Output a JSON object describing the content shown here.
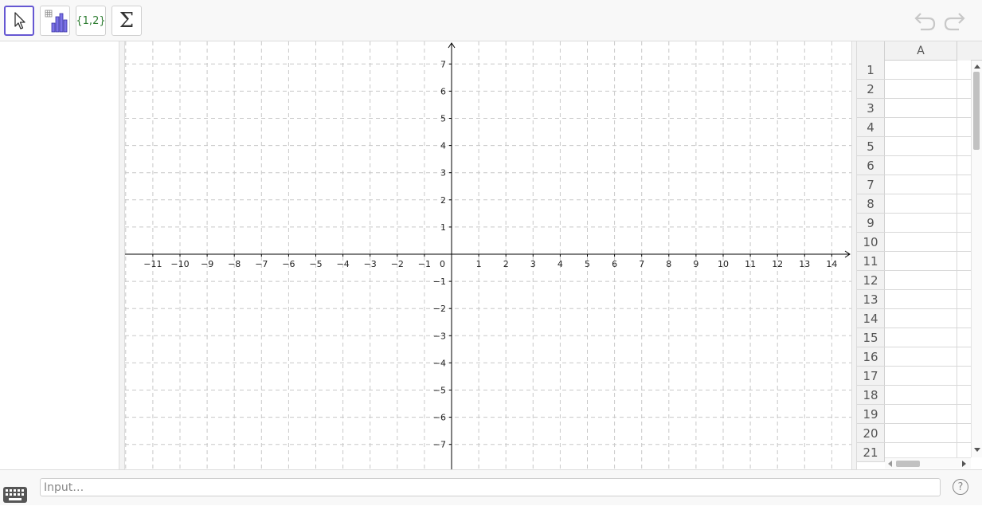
{
  "toolbar": {
    "tools": [
      {
        "id": "move",
        "icon": "pointer-arrow-icon",
        "active": true
      },
      {
        "id": "one-variable-analysis",
        "icon": "bar-chart-icon",
        "active": false
      },
      {
        "id": "create-list",
        "icon": "list-braces-icon",
        "label": "{1,2}",
        "active": false
      },
      {
        "id": "sum",
        "icon": "sigma-icon",
        "label": "Σ",
        "active": false
      }
    ],
    "undo_icon": "undo-icon",
    "redo_icon": "redo-icon"
  },
  "graphics": {
    "x_ticks": [
      "−11",
      "−10",
      "−9",
      "−8",
      "−7",
      "−6",
      "−5",
      "−4",
      "−3",
      "−2",
      "−1",
      "1",
      "2",
      "3",
      "4",
      "5",
      "6",
      "7",
      "8",
      "9",
      "10",
      "11",
      "12",
      "13",
      "14"
    ],
    "y_ticks_pos": [
      "1",
      "2",
      "3",
      "4",
      "5",
      "6",
      "7"
    ],
    "y_ticks_neg": [
      "−1",
      "−2",
      "−3",
      "−4",
      "−5",
      "−6",
      "−7"
    ],
    "origin_label": "0",
    "axis_color": "#000000",
    "grid_color": "#c8c8c8"
  },
  "spreadsheet": {
    "column_header": "A",
    "rows": [
      "1",
      "2",
      "3",
      "4",
      "5",
      "6",
      "7",
      "8",
      "9",
      "10",
      "11",
      "12",
      "13",
      "14",
      "15",
      "16",
      "17",
      "18",
      "19",
      "20",
      "21"
    ]
  },
  "input_bar": {
    "placeholder": "Input…",
    "help_label": "?",
    "keyboard_icon": "keyboard-icon"
  },
  "colors": {
    "active_tool_border": "#6557d2",
    "chart_icon": "#6557d2",
    "list_text": "#2e7d32"
  }
}
